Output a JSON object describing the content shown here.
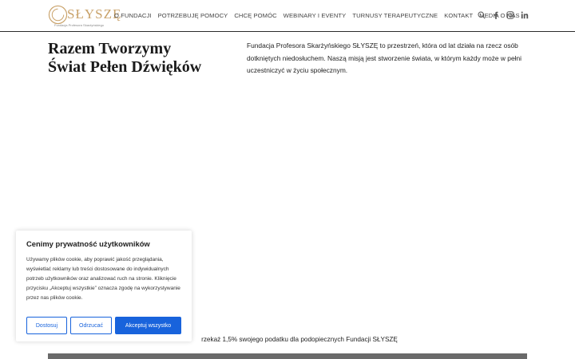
{
  "header": {
    "logo_text": "SŁYSZĘ",
    "logo_sub": "Fundacja Profesora Skarżyńskiego",
    "nav": [
      {
        "label": "O FUNDACJI"
      },
      {
        "label": "POTRZEBUJĘ POMOCY"
      },
      {
        "label": "CHCĘ POMÓC"
      },
      {
        "label": "WEBINARY I EVENTY"
      },
      {
        "label": "TURNUSY TERAPEUTYCZNE"
      },
      {
        "label": "KONTAKT"
      },
      {
        "label": "MEDIA O NAS"
      }
    ],
    "icons": [
      "search-icon",
      "facebook-icon",
      "instagram-icon",
      "linkedin-icon"
    ]
  },
  "hero": {
    "title_line1": "Razem Tworzymy",
    "title_line2": "Świat Pełen Dźwięków",
    "text": "Fundacja Profesora Skarżyńskiego SŁYSZĘ to przestrzeń, która od lat działa na rzecz osób dotkniętych niedosłuchem. Naszą misją jest stworzenie świata, w którym każdy może w pełni uczestniczyć w życiu społecznym."
  },
  "tax_line": "rzekaż 1,5% swojego podatku dla podopiecznych Fundacji SŁYSZĘ",
  "cookie": {
    "title": "Cenimy prywatność użytkowników",
    "text": "Używamy plików cookie, aby poprawić jakość przeglądania, wyświetlać reklamy lub treści dostosowane do indywidualnych potrzeb użytkowników oraz analizować ruch na stronie. Kliknięcie przycisku „Akceptuj wszystkie” oznacza zgodę na wykorzystywanie przez nas plików cookie.",
    "btn_customize": "Dostosuj",
    "btn_reject": "Odrzucać",
    "btn_accept": "Akceptuj wszystko"
  },
  "colors": {
    "accent_gold": "#c9a26a",
    "cookie_blue": "#1863dc"
  }
}
